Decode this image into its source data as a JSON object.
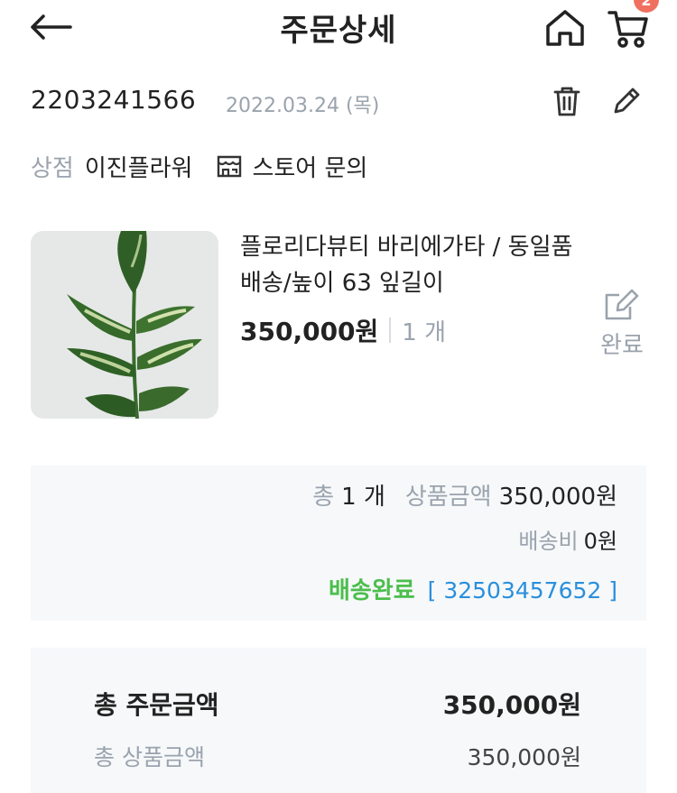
{
  "header": {
    "title": "주문상세",
    "cart_badge": "2",
    "icons": {
      "back": "arrow-left-icon",
      "home": "home-icon",
      "cart": "cart-icon"
    }
  },
  "order": {
    "number": "2203241566",
    "date": "2022.03.24 (목)",
    "icons": {
      "delete": "trash-icon",
      "edit": "pencil-icon"
    }
  },
  "store": {
    "label": "상점",
    "name": "이진플라워",
    "inquiry_label": "스토어 문의",
    "inquiry_icon": "store-icon"
  },
  "product": {
    "name": "플로리다뷰티 바리에가타 / 동일품배송/높이 63 잎길이",
    "price": "350,000원",
    "quantity": "1 개",
    "review_label": "완료",
    "review_icon": "write-review-icon",
    "image_icon": "plant-photo"
  },
  "summary": {
    "total_prefix": "총",
    "total_count": "1 개",
    "goods_amount_label": "상품금액",
    "goods_amount": "350,000원",
    "shipping_label": "배송비",
    "shipping_fee": "0원",
    "delivery_status": "배송완료",
    "tracking_number": "[ 32503457652 ]"
  },
  "totals": {
    "order_total_label": "총 주문금액",
    "order_total": "350,000원",
    "goods_total_label": "총 상품금액",
    "goods_total": "350,000원"
  },
  "colors": {
    "muted": "#9aa3ad",
    "accent_green": "#4cbe4c",
    "link_blue": "#2a8fdc",
    "badge": "#f07060",
    "panel_bg": "#f6f8fa"
  }
}
